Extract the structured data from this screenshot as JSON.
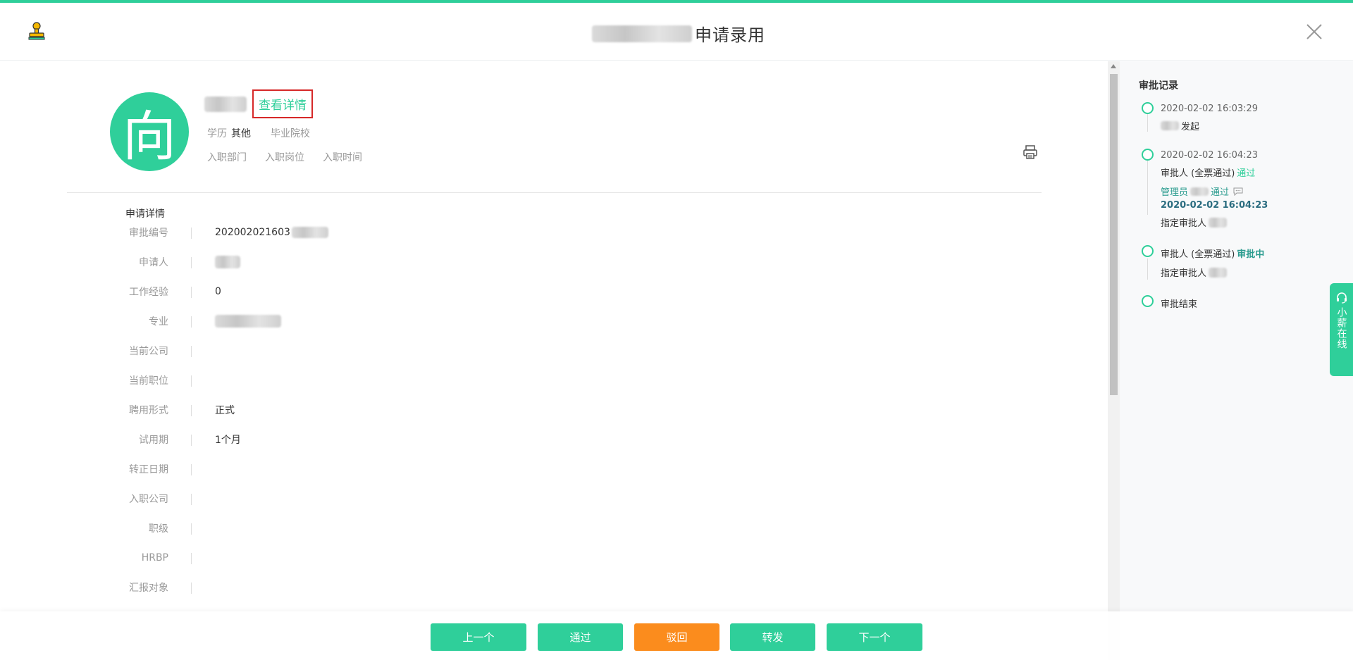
{
  "header": {
    "title_suffix": "申请录用",
    "close_label": "×"
  },
  "profile": {
    "avatar_char": "向",
    "view_detail": "查看详情",
    "education_label": "学历",
    "education_value": "其他",
    "school_label": "毕业院校",
    "dept_label": "入职部门",
    "position_label": "入职岗位",
    "entry_time_label": "入职时间"
  },
  "details": {
    "section_title": "申请详情",
    "fields": [
      {
        "label": "审批编号",
        "value": "202002021603"
      },
      {
        "label": "申请人",
        "value": ""
      },
      {
        "label": "工作经验",
        "value": "0"
      },
      {
        "label": "专业",
        "value": ""
      },
      {
        "label": "当前公司",
        "value": ""
      },
      {
        "label": "当前职位",
        "value": ""
      },
      {
        "label": "聘用形式",
        "value": "正式"
      },
      {
        "label": "试用期",
        "value": "1个月"
      },
      {
        "label": "转正日期",
        "value": ""
      },
      {
        "label": "入职公司",
        "value": ""
      },
      {
        "label": "职级",
        "value": ""
      },
      {
        "label": "HRBP",
        "value": ""
      },
      {
        "label": "汇报对象",
        "value": ""
      }
    ]
  },
  "approval": {
    "title": "审批记录",
    "step1_time": "2020-02-02 16:03:29",
    "step1_action": "发起",
    "step2_time": "2020-02-02 16:04:23",
    "step2_label": "审批人 (全票通过)",
    "step2_status": "通过",
    "step2_admin": "管理员",
    "step2_admin_status": "通过",
    "step2_admin_time": "2020-02-02 16:04:23",
    "step2_assign": "指定审批人",
    "step3_label": "审批人 (全票通过)",
    "step3_status": "审批中",
    "step3_assign": "指定审批人",
    "step4_label": "审批结束"
  },
  "help": {
    "label": "小薪在线"
  },
  "actions": {
    "prev": "上一个",
    "pass": "通过",
    "reject": "驳回",
    "forward": "转发",
    "next": "下一个"
  },
  "colors": {
    "accent": "#2fcf9a",
    "reject": "#fb8c1d",
    "highlight_border": "#d62828"
  }
}
